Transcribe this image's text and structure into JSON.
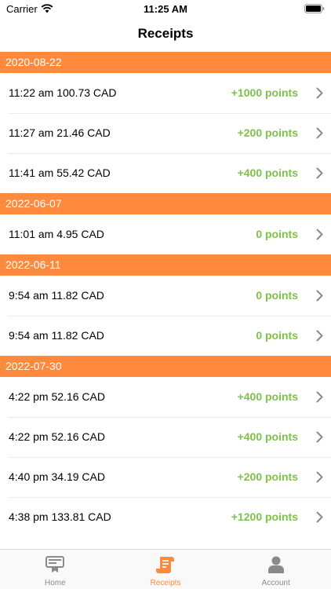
{
  "status_bar": {
    "carrier": "Carrier",
    "time": "11:25 AM"
  },
  "nav": {
    "title": "Receipts"
  },
  "colors": {
    "accent": "#FF8A3D",
    "points": "#7DC24A",
    "tab_inactive": "#8A8A8E"
  },
  "sections": [
    {
      "date": "2020-08-22",
      "rows": [
        {
          "text": "11:22 am 100.73 CAD",
          "points": "+1000 points"
        },
        {
          "text": "11:27 am 21.46 CAD",
          "points": "+200 points"
        },
        {
          "text": "11:41 am 55.42 CAD",
          "points": "+400 points"
        }
      ]
    },
    {
      "date": "2022-06-07",
      "rows": [
        {
          "text": "11:01 am 4.95 CAD",
          "points": "0 points"
        }
      ]
    },
    {
      "date": "2022-06-11",
      "rows": [
        {
          "text": "9:54 am 11.82 CAD",
          "points": "0 points"
        },
        {
          "text": "9:54 am 11.82 CAD",
          "points": "0 points"
        }
      ]
    },
    {
      "date": "2022-07-30",
      "rows": [
        {
          "text": "4:22 pm 52.16 CAD",
          "points": "+400 points"
        },
        {
          "text": "4:22 pm 52.16 CAD",
          "points": "+400 points"
        },
        {
          "text": "4:40 pm 34.19 CAD",
          "points": "+200 points"
        },
        {
          "text": "4:38 pm 133.81 CAD",
          "points": "+1200 points"
        }
      ]
    }
  ],
  "tabs": [
    {
      "label": "Home",
      "icon": "home-icon",
      "active": false
    },
    {
      "label": "Receipts",
      "icon": "receipt-icon",
      "active": true
    },
    {
      "label": "Account",
      "icon": "account-icon",
      "active": false
    }
  ]
}
